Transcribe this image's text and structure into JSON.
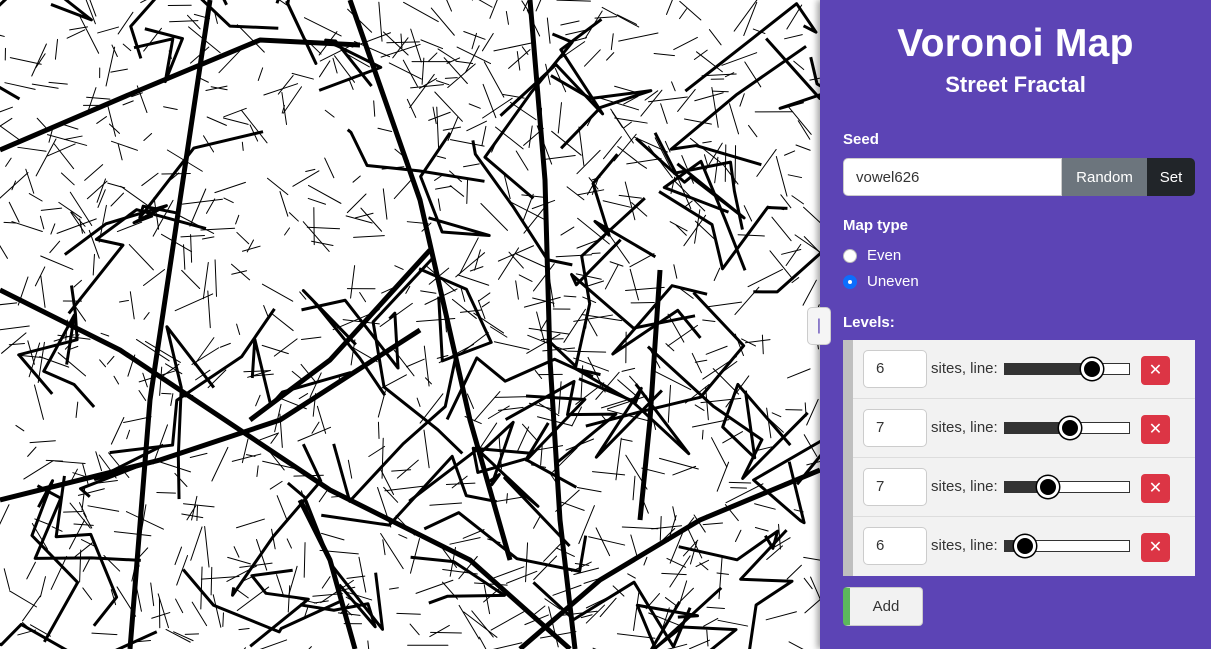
{
  "app": {
    "title": "Voronoi Map",
    "subtitle": "Street Fractal"
  },
  "seed": {
    "label": "Seed",
    "value": "vowel626",
    "random_label": "Random",
    "set_label": "Set"
  },
  "map_type": {
    "label": "Map type",
    "options": [
      {
        "label": "Even",
        "checked": false
      },
      {
        "label": "Uneven",
        "checked": true
      }
    ]
  },
  "levels": {
    "label": "Levels:",
    "items": [
      {
        "sites": "6",
        "text": "sites, line:",
        "line_fraction": 0.68
      },
      {
        "sites": "7",
        "text": "sites, line:",
        "line_fraction": 0.5
      },
      {
        "sites": "7",
        "text": "sites, line:",
        "line_fraction": 0.32
      },
      {
        "sites": "6",
        "text": "sites, line:",
        "line_fraction": 0.14
      }
    ],
    "delete_symbol": "✕",
    "add_label": "Add"
  },
  "toggle": {
    "symbol": "|"
  },
  "colors": {
    "panel_bg": "#5c44b5",
    "random_btn": "#6c757d",
    "set_btn": "#212529",
    "delete_btn": "#dc3545",
    "add_accent": "#5cb85c",
    "radio_on": "#0d6efd"
  }
}
